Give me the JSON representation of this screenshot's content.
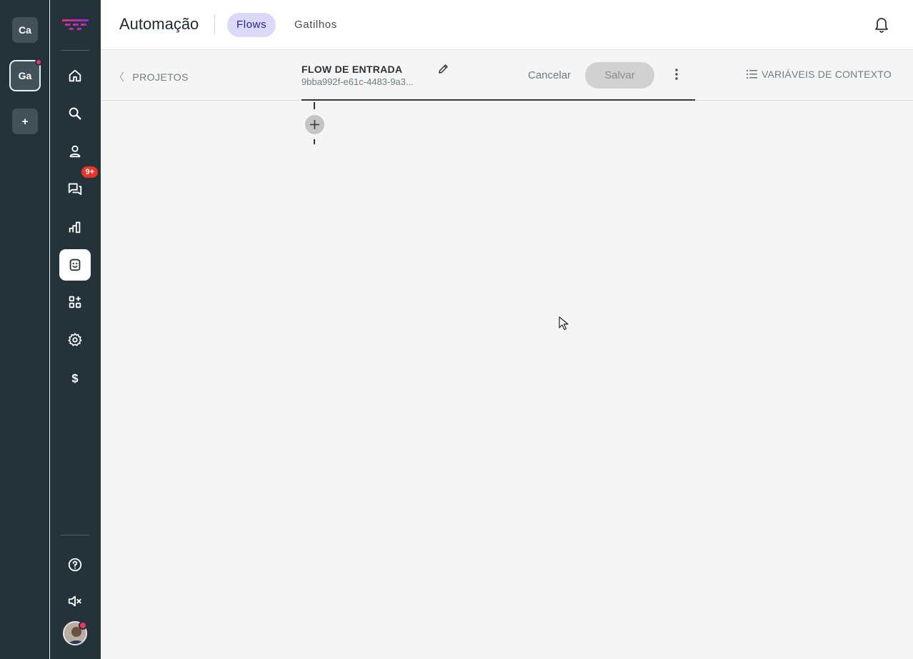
{
  "workspaces": [
    {
      "initials": "Ca",
      "notification": false
    },
    {
      "initials": "Ga",
      "notification": true,
      "active": true
    },
    {
      "initials": "+",
      "add": true
    }
  ],
  "nav": {
    "items": [
      {
        "name": "home-icon"
      },
      {
        "name": "search-icon"
      },
      {
        "name": "contacts-icon"
      },
      {
        "name": "chat-icon",
        "badge": "9+"
      },
      {
        "name": "reports-icon"
      },
      {
        "name": "automation-bot-icon",
        "active": true
      },
      {
        "name": "apps-icon"
      },
      {
        "name": "settings-icon"
      },
      {
        "name": "billing-icon"
      },
      {
        "name": "help-icon"
      },
      {
        "name": "mute-icon"
      }
    ],
    "badge": "9+"
  },
  "header": {
    "title": "Automação",
    "tabs": [
      {
        "label": "Flows",
        "active": true
      },
      {
        "label": "Gatilhos",
        "active": false
      }
    ]
  },
  "toolbar": {
    "back_label": "PROJETOS",
    "flow_name": "FLOW DE ENTRADA",
    "flow_id": "9bba992f-e61c-4483-9a3...",
    "cancel_label": "Cancelar",
    "save_label": "Salvar",
    "context_vars_label": "VARIÁVEIS DE CONTEXTO"
  },
  "colors": {
    "sidebar_bg": "#24333a",
    "accent_tab_bg": "#dcd8f8",
    "accent_tab_text": "#2a2280",
    "badge": "#e8352b",
    "notification_dot": "#e8336f",
    "save_disabled_bg": "#d1d1d1"
  }
}
